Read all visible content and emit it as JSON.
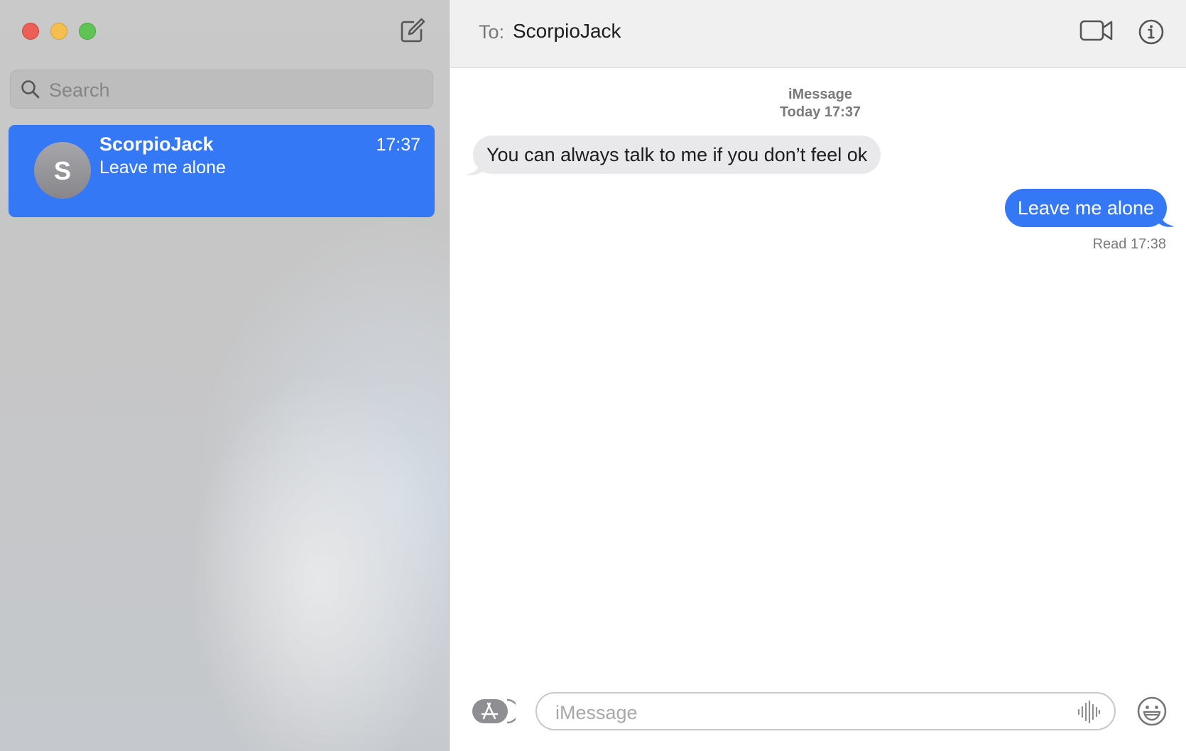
{
  "sidebar": {
    "window_controls": [
      "close",
      "minimize",
      "zoom"
    ],
    "compose_icon": "compose-icon",
    "search": {
      "placeholder": "Search",
      "icon": "search-icon"
    },
    "conversations": [
      {
        "name": "ScorpioJack",
        "initial": "S",
        "time": "17:37",
        "preview": "Leave me alone",
        "selected": true
      }
    ]
  },
  "header": {
    "to_label": "To:",
    "recipient": "ScorpioJack",
    "icons": [
      "video-call-icon",
      "info-icon"
    ]
  },
  "thread": {
    "service": "iMessage",
    "timestamp": "Today 17:37",
    "messages": [
      {
        "direction": "incoming",
        "text": "You can always talk to me if you don’t feel ok"
      },
      {
        "direction": "outgoing",
        "text": "Leave me alone"
      }
    ],
    "read_receipt": "Read 17:38"
  },
  "composer": {
    "placeholder": "iMessage",
    "icons": [
      "app-store-icon",
      "audio-waveform-icon",
      "emoji-icon"
    ]
  },
  "colors": {
    "accent": "#3478f6",
    "incoming_bubble": "#e9e9eb",
    "close": "#ec5f57",
    "minimize": "#f5bf4f",
    "zoom": "#60c454"
  }
}
